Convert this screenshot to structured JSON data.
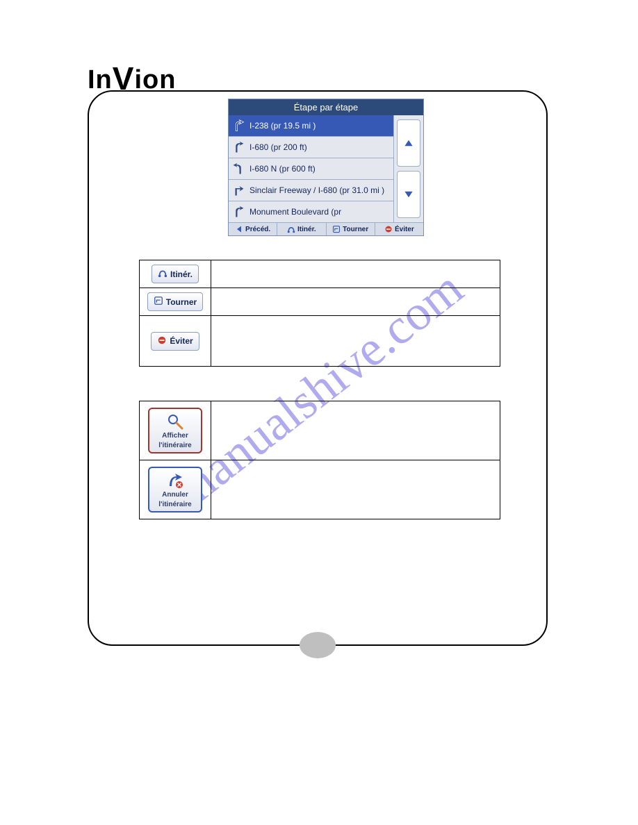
{
  "brand": {
    "text_a": "In",
    "text_b": "V",
    "text_c": "ion"
  },
  "gps": {
    "title": "Étape par étape",
    "items": [
      {
        "text": "I-238 (pr 19.5 mi )",
        "turn": "merge-right",
        "selected": true
      },
      {
        "text": "I-680 (pr 200 ft)",
        "turn": "merge-right",
        "selected": false
      },
      {
        "text": "I-680 N (pr 600 ft)",
        "turn": "bear-left",
        "selected": false
      },
      {
        "text": "Sinclair Freeway / I-680 (pr 31.0 mi )",
        "turn": "turn-right",
        "selected": false
      },
      {
        "text": "Monument Boulevard (pr",
        "turn": "merge-right",
        "selected": false
      }
    ],
    "footer": [
      {
        "label": "Précéd.",
        "icon": "back"
      },
      {
        "label": "Itinér.",
        "icon": "route"
      },
      {
        "label": "Tourner",
        "icon": "turn"
      },
      {
        "label": "Éviter",
        "icon": "avoid"
      }
    ]
  },
  "table1": {
    "rows": [
      {
        "icon": "route",
        "label": "Itinér.",
        "desc": ""
      },
      {
        "icon": "turn",
        "label": "Tourner",
        "desc": ""
      },
      {
        "icon": "avoid",
        "label": "Éviter",
        "desc": ""
      }
    ]
  },
  "table2": {
    "rows": [
      {
        "icon": "magnifier",
        "line1": "Afficher",
        "line2": "l'itinéraire",
        "desc": "",
        "border": "red"
      },
      {
        "icon": "cancel",
        "line1": "Annuler",
        "line2": "l'itinéraire",
        "desc": "",
        "border": "blue"
      }
    ]
  },
  "watermark": "manualshive.com"
}
